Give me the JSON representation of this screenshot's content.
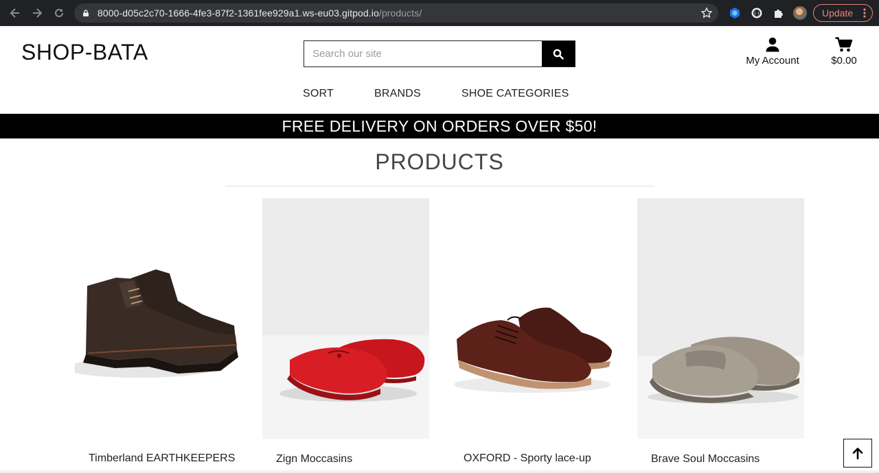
{
  "browser": {
    "url_host": "8000-d05c2c70-1666-4fe3-87f2-1361fee929a1.ws-eu03.gitpod.io",
    "url_path": "/products/",
    "update_label": "Update"
  },
  "header": {
    "brand": "SHOP-BATA",
    "search_placeholder": "Search our site",
    "account_label": "My Account",
    "cart_total": "$0.00"
  },
  "nav": {
    "items": [
      {
        "label": "SORT"
      },
      {
        "label": "BRANDS"
      },
      {
        "label": "SHOE CATEGORIES"
      }
    ]
  },
  "banner": {
    "text": "FREE DELIVERY ON ORDERS OVER $50!"
  },
  "products": {
    "title": "PRODUCTS",
    "items": [
      {
        "name": "Timberland EARTHKEEPERS"
      },
      {
        "name": "Zign Moccasins"
      },
      {
        "name": "OXFORD - Sporty lace-up"
      },
      {
        "name": "Brave Soul Moccasins"
      }
    ]
  },
  "colors": {
    "chrome_bg": "#202124",
    "banner_bg": "#000000",
    "update_accent": "#e8837c"
  },
  "icons": [
    "back-arrow-icon",
    "forward-arrow-icon",
    "reload-icon",
    "lock-icon",
    "star-icon",
    "extension-icon",
    "puzzle-icon",
    "search-icon",
    "user-icon",
    "cart-icon",
    "arrow-up-icon",
    "more-vert-icon"
  ]
}
